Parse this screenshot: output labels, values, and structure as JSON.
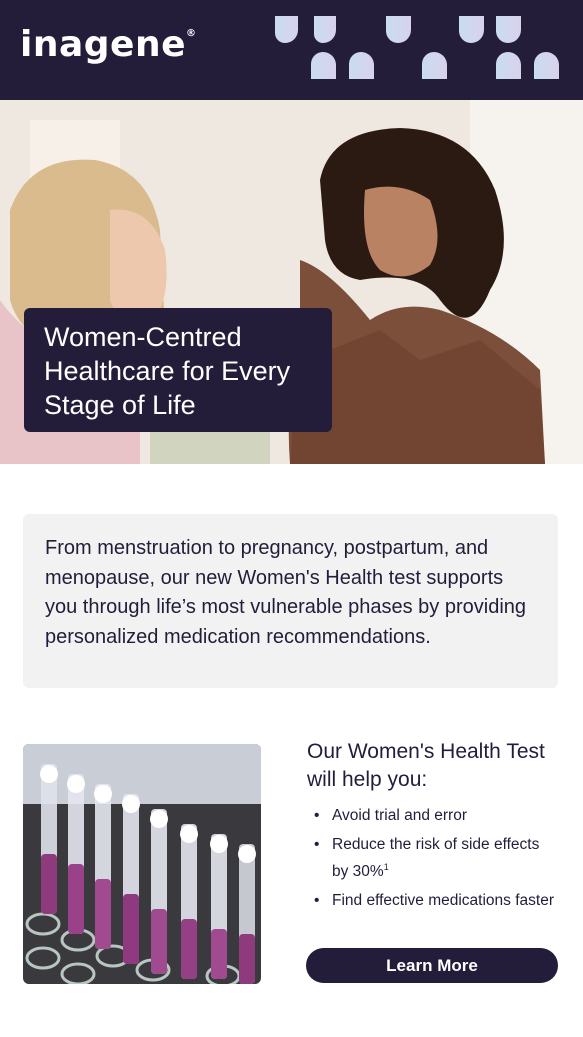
{
  "brand": {
    "logo_text": "inagene",
    "logo_mark": "®"
  },
  "colors": {
    "primary": "#231d39",
    "panel": "#f2f2f2",
    "drop_blue": "#c9dcf0",
    "drop_lavender": "#d8d2ec"
  },
  "hero": {
    "title": "Women-Centred Healthcare for Every Stage of Life"
  },
  "intro": {
    "text": "From menstruation to pregnancy, postpartum, and menopause, our new Women's Health test supports you through life’s most vulnerable phases by providing personalized medication recommendations."
  },
  "benefits": {
    "title": "Our Women's Health Test will help you:",
    "items": [
      {
        "text": "Avoid trial and error",
        "sup": ""
      },
      {
        "text": "Reduce the risk of side effects by 30%",
        "sup": "1"
      },
      {
        "text": "Find effective medications faster",
        "sup": ""
      }
    ],
    "bullet": "•"
  },
  "cta": {
    "label": "Learn More"
  },
  "icons": {
    "decoration": "droplet-pattern",
    "hero_image": "two-women-talking-photo",
    "lab_image": "test-tubes-photo"
  }
}
